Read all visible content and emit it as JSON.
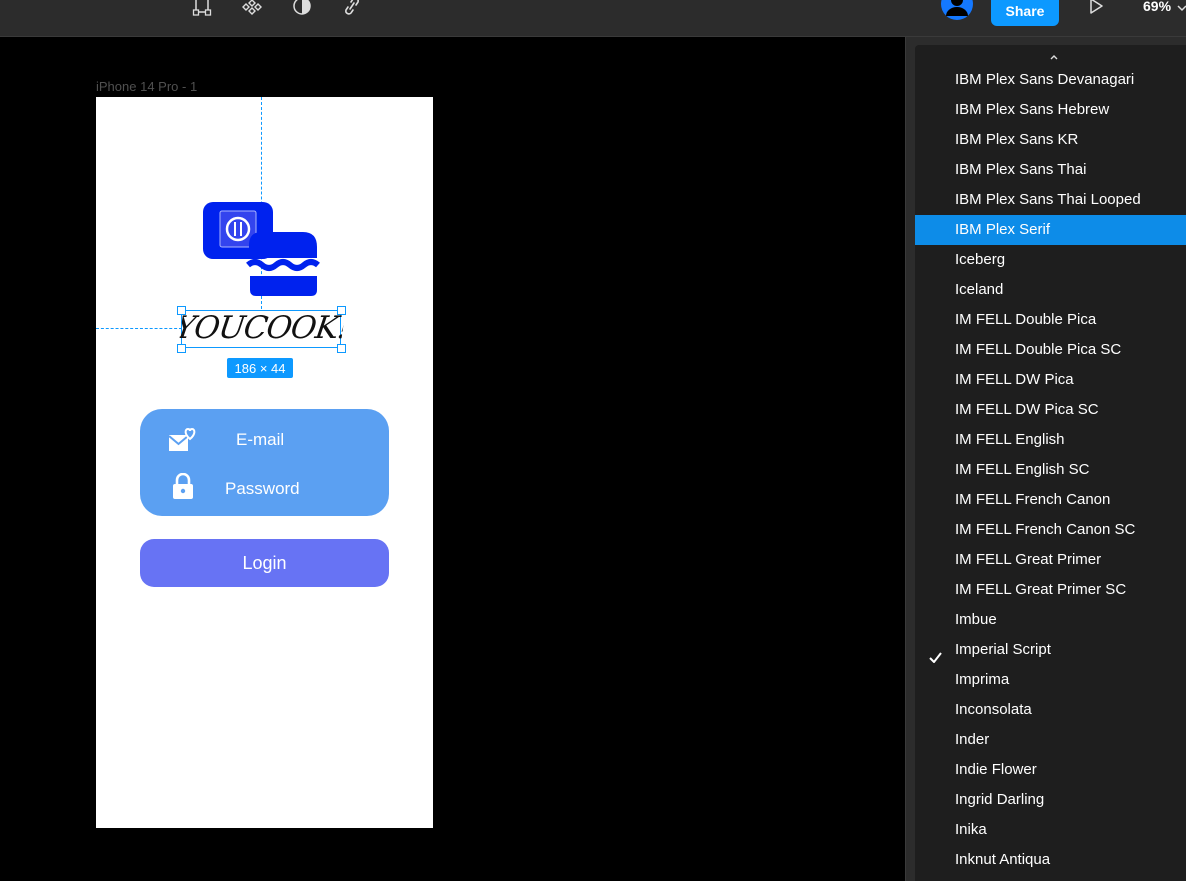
{
  "toolbar": {
    "share_label": "Share",
    "zoom_label": "69%",
    "icons": [
      "vector-network-icon",
      "components-icon",
      "contrast-icon",
      "link-icon",
      "avatar-icon",
      "play-icon",
      "chevron-down-icon"
    ]
  },
  "canvas": {
    "frame_label": "iPhone 14 Pro - 1",
    "selection_size": "186 × 44"
  },
  "app_screen": {
    "title": "YOUCOOK!",
    "email_label": "E-mail",
    "password_label": "Password",
    "login_label": "Login"
  },
  "font_dropdown": {
    "items": [
      "IBM Plex Sans Devanagari",
      "IBM Plex Sans Hebrew",
      "IBM Plex Sans KR",
      "IBM Plex Sans Thai",
      "IBM Plex Sans Thai Looped",
      "IBM Plex Serif",
      "Iceberg",
      "Iceland",
      "IM FELL Double Pica",
      "IM FELL Double Pica SC",
      "IM FELL DW Pica",
      "IM FELL DW Pica SC",
      "IM FELL English",
      "IM FELL English SC",
      "IM FELL French Canon",
      "IM FELL French Canon SC",
      "IM FELL Great Primer",
      "IM FELL Great Primer SC",
      "Imbue",
      "Imperial Script",
      "Imprima",
      "Inconsolata",
      "Inder",
      "Indie Flower",
      "Ingrid Darling",
      "Inika",
      "Inknut Antiqua"
    ],
    "highlighted": "IBM Plex Serif",
    "selected": "Imperial Script"
  },
  "colors": {
    "accent": "#0d99ff",
    "card": "#5ba0f2",
    "button": "#6773f4",
    "logo": "#0022ee"
  }
}
